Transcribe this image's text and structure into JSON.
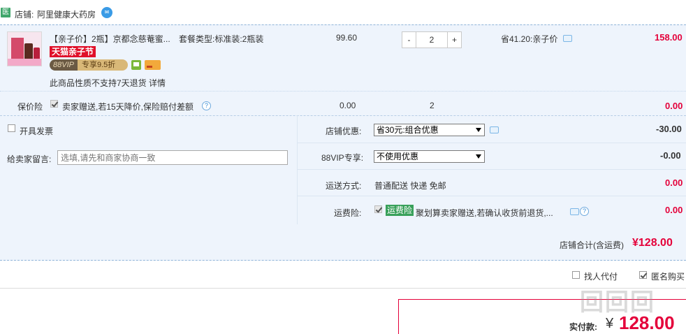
{
  "shop": {
    "badge": "医",
    "label": "店铺:",
    "name": "阿里健康大药房"
  },
  "item": {
    "title": "【亲子价】2瓶】京都念慈菴蜜...",
    "sku": "套餐类型:标准装:2瓶装",
    "promo_tag": "天猫亲子节",
    "vip_left": "88VIP",
    "vip_right": "专享9.5折",
    "no_return": "此商品性质不支持7天退货 详情",
    "unit_price": "99.60",
    "qty_minus": "-",
    "qty_value": "2",
    "qty_plus": "+",
    "saving": "省41.20:亲子价",
    "total": "158.00"
  },
  "insurance": {
    "label": "保价险",
    "text": "卖家赠送,若15天降价,保险赔付差额",
    "help": "?",
    "price": "0.00",
    "qty": "2",
    "total": "0.00"
  },
  "invoice": {
    "label": "开具发票"
  },
  "message": {
    "label": "给卖家留言:",
    "placeholder": "选填,请先和商家协商一致"
  },
  "options": {
    "shop_discount_label": "店铺优惠:",
    "shop_discount_value": "省30元:组合优惠",
    "shop_discount_amount": "-30.00",
    "vip_label": "88VIP专享:",
    "vip_value": "不使用优惠",
    "vip_amount": "-0.00",
    "shipping_label": "运送方式:",
    "shipping_value": "普通配送 快递 免邮",
    "shipping_amount": "0.00",
    "freight_ins_label": "运费险:",
    "freight_ins_tag": "运费险",
    "freight_ins_text": "聚划算卖家赠送,若确认收货前退货,...",
    "freight_ins_amount": "0.00"
  },
  "subtotal": {
    "label": "店铺合计(含运费)",
    "value": "¥128.00"
  },
  "bottom": {
    "friend_pay": "找人代付",
    "anonymous": "匿名购买",
    "pay_label": "实付款:",
    "pay_yen": "¥",
    "pay_value": "128.00",
    "watermark": "回回回"
  },
  "colors": {
    "accent_red": "#e4003a",
    "panel_bg": "#eef4fc",
    "promo_red": "#e0102a",
    "green": "#38a05a"
  }
}
